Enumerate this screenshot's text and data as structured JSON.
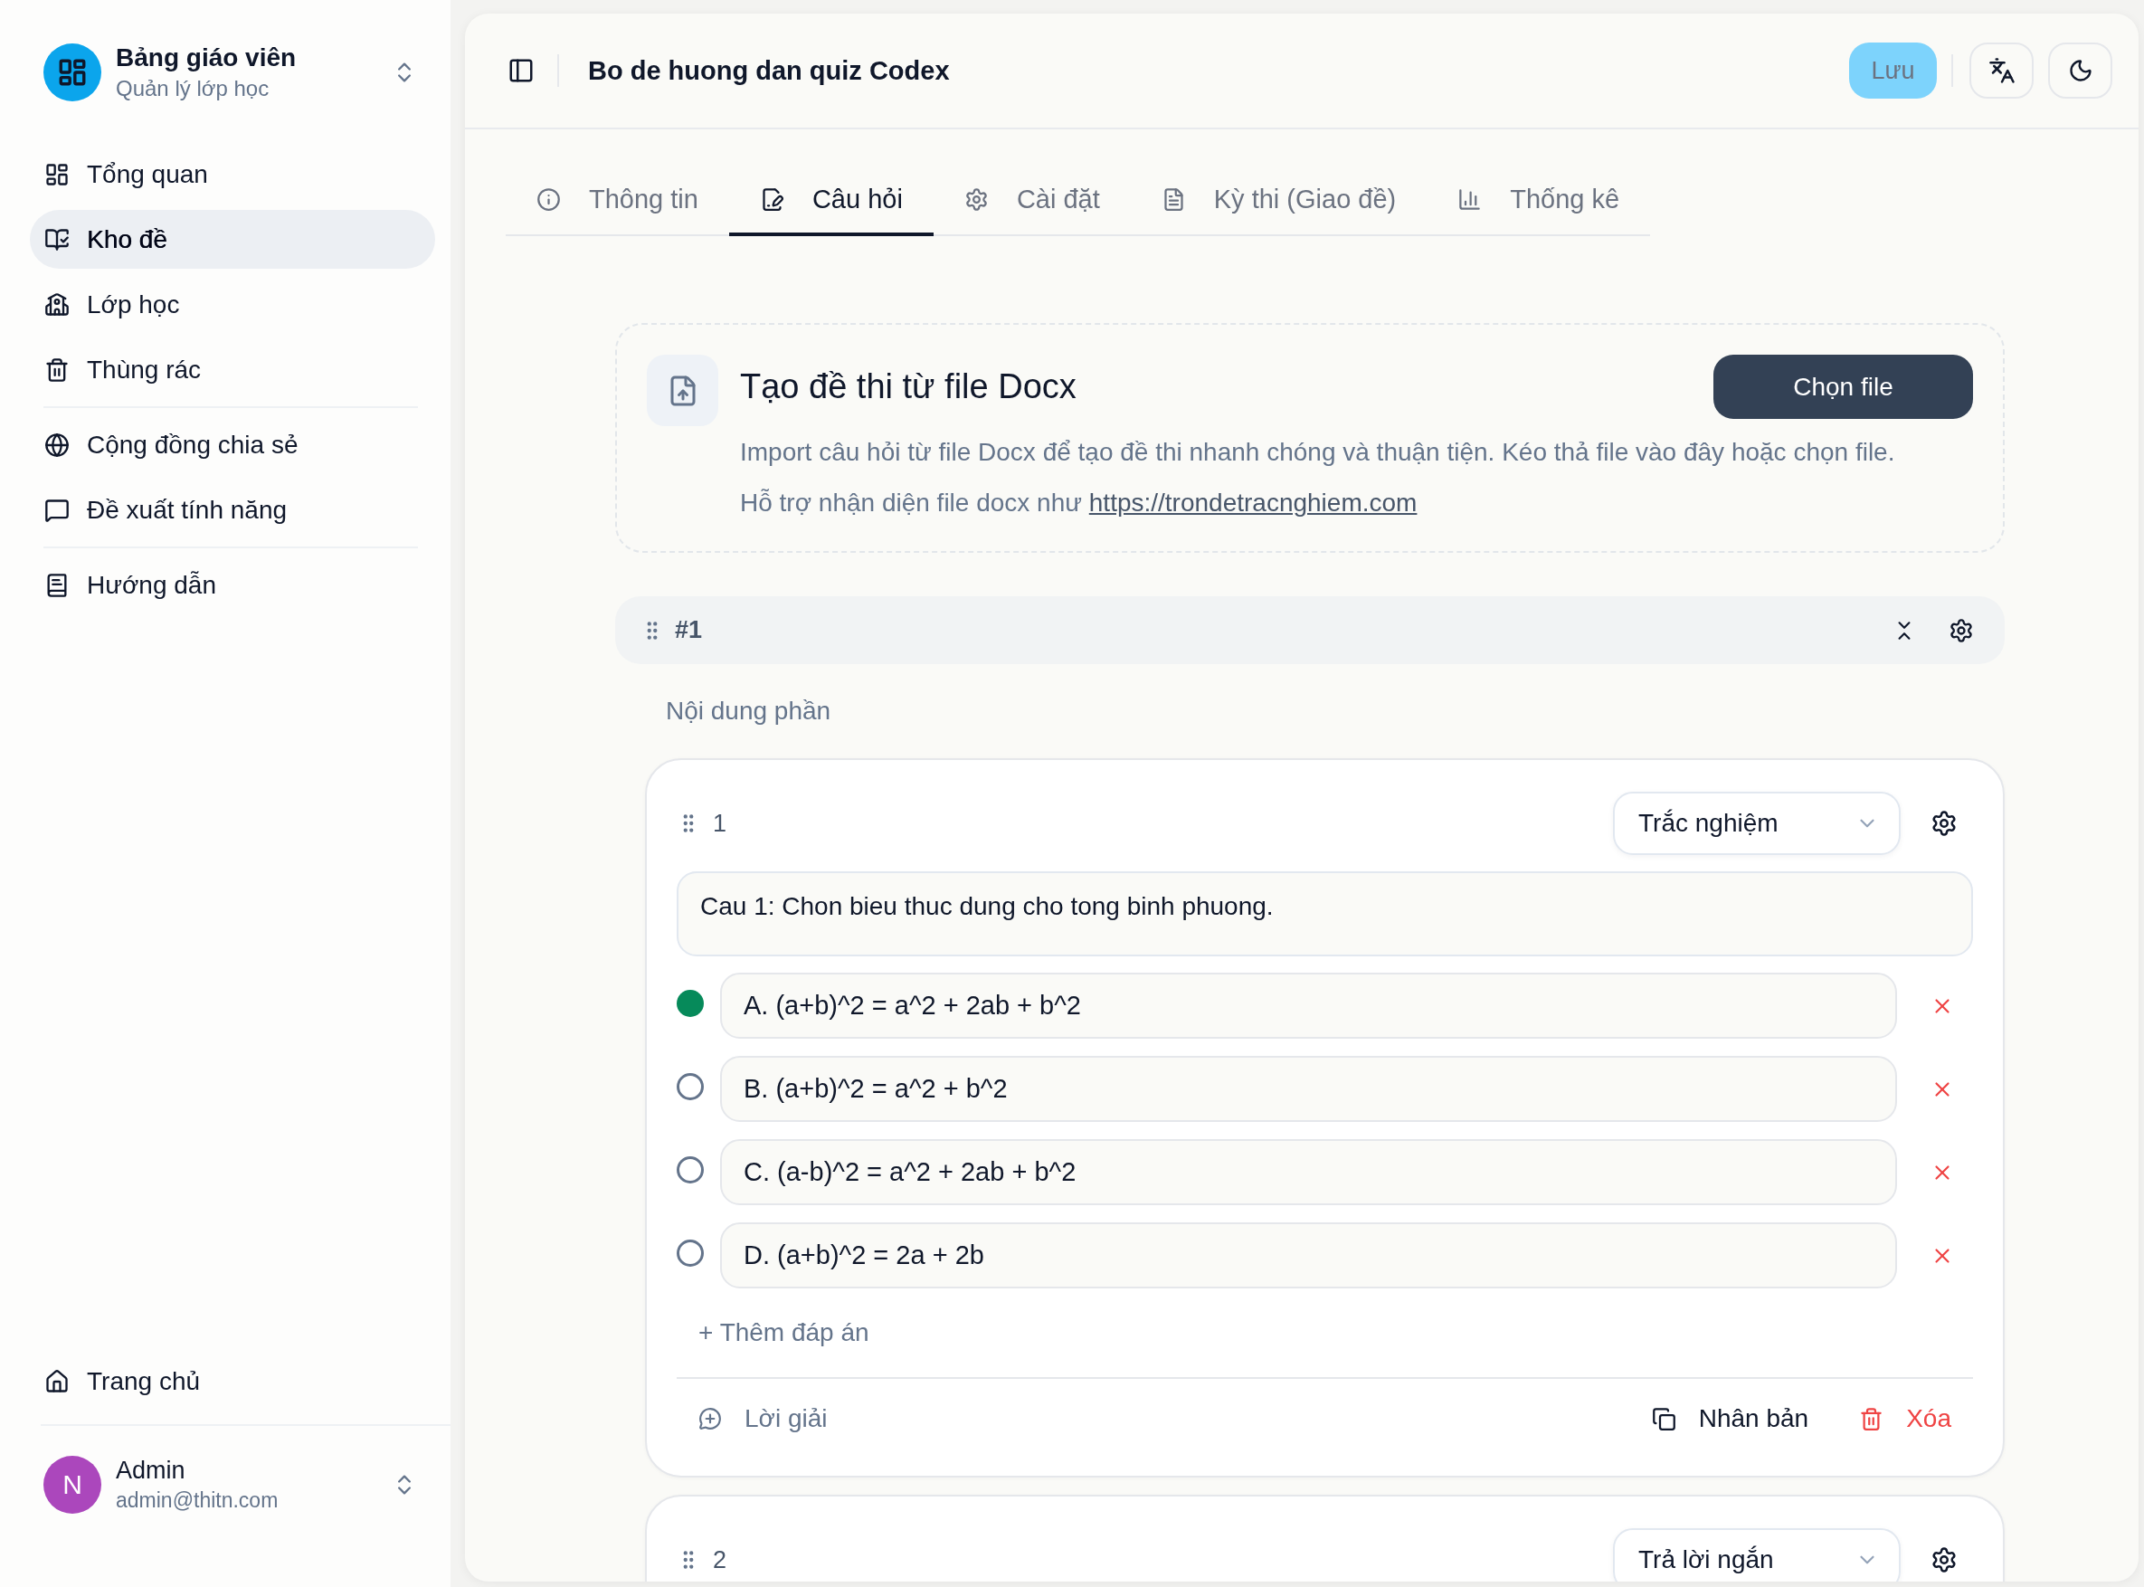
{
  "sidebar": {
    "brand": {
      "title": "Bảng giáo viên",
      "subtitle": "Quản lý lớp học"
    },
    "nav_groups": [
      {
        "items": [
          {
            "label": "Tổng quan",
            "selected": false
          },
          {
            "label": "Kho đề",
            "selected": true
          },
          {
            "label": "Lớp học",
            "selected": false
          },
          {
            "label": "Thùng rác",
            "selected": false
          }
        ]
      },
      {
        "items": [
          {
            "label": "Cộng đồng chia sẻ",
            "selected": false
          },
          {
            "label": "Đề xuất tính năng",
            "selected": false
          }
        ]
      },
      {
        "items": [
          {
            "label": "Hướng dẫn",
            "selected": false
          }
        ]
      }
    ],
    "bottom_items": [
      {
        "label": "Trang chủ",
        "selected": false
      }
    ],
    "user": {
      "initial": "N",
      "name": "Admin",
      "email": "admin@thitn.com"
    }
  },
  "header": {
    "title": "Bo de huong dan quiz Codex",
    "save_button": {
      "label": "Lưu",
      "disabled": true
    }
  },
  "tabs": [
    {
      "label": "Thông tin",
      "selected": false
    },
    {
      "label": "Câu hỏi",
      "selected": true
    },
    {
      "label": "Cài đặt",
      "selected": false
    },
    {
      "label": "Kỳ thi (Giao đề)",
      "selected": false
    },
    {
      "label": "Thống kê",
      "selected": false
    }
  ],
  "import_card": {
    "title": "Tạo đề thi từ file Docx",
    "button": "Chọn file",
    "description": "Import câu hỏi từ file Docx để tạo đề thi nhanh chóng và thuận tiện. Kéo thả file vào đây hoặc chọn file.",
    "support_text": "Hỗ trợ nhận diện file docx như",
    "link": "https://trondetracnghiem.com"
  },
  "section": {
    "number": "#1",
    "placeholder": "Nội dung phần"
  },
  "questions": [
    {
      "number": "1",
      "type": "Trắc nghiệm",
      "text": "Cau 1: Chon bieu thuc dung cho tong binh phuong.",
      "answers": [
        {
          "text": "A. (a+b)^2 = a^2 + 2ab + b^2",
          "selected": true
        },
        {
          "text": "B. (a+b)^2 = a^2 + b^2",
          "selected": false
        },
        {
          "text": "C. (a-b)^2 = a^2 + 2ab + b^2",
          "selected": false
        },
        {
          "text": "D. (a+b)^2 = 2a + 2b",
          "selected": false
        }
      ],
      "add_answer": "+ Thêm đáp án",
      "actions": {
        "solution": "Lời giải",
        "duplicate": "Nhân bản",
        "delete": "Xóa"
      }
    },
    {
      "number": "2",
      "type": "Trả lời ngắn"
    }
  ]
}
